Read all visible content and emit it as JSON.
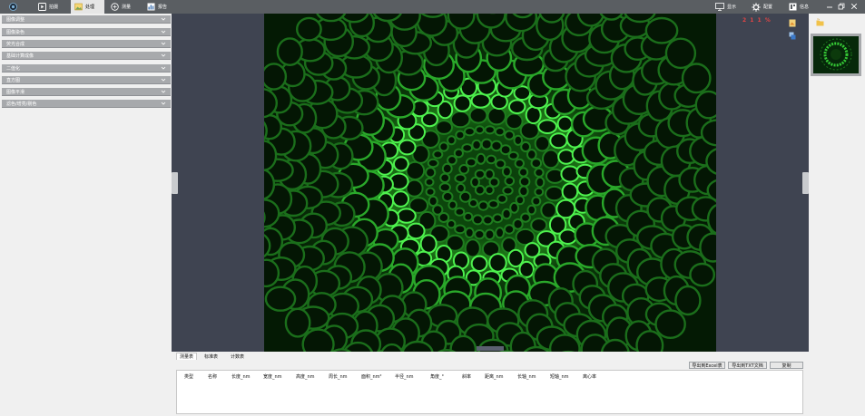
{
  "toolbar": {
    "nav": [
      {
        "label": ""
      },
      {
        "label": "拍摄"
      },
      {
        "label": "处理"
      },
      {
        "label": "测量"
      },
      {
        "label": "报告"
      }
    ],
    "right": [
      {
        "label": "显示"
      },
      {
        "label": "配置"
      },
      {
        "label": "信息"
      }
    ]
  },
  "left_panel": {
    "items": [
      {
        "label": "图像调整"
      },
      {
        "label": "图像染色"
      },
      {
        "label": "荧光合成"
      },
      {
        "label": "基础计算成像"
      },
      {
        "label": "二值化"
      },
      {
        "label": "直方图"
      },
      {
        "label": "图像平滑"
      },
      {
        "label": "滤色/增亮/剔色"
      }
    ]
  },
  "viewer": {
    "stamp": "2 1 1 %"
  },
  "bottom": {
    "tabs": [
      {
        "label": "测量表"
      },
      {
        "label": "标准表"
      },
      {
        "label": "计数表"
      }
    ],
    "buttons": {
      "export_excel": "导出到Excel表",
      "export_txt": "导出到TXT文档",
      "copy": "复制"
    },
    "columns": [
      "类型",
      "名称",
      "长度_nm",
      "宽度_nm",
      "高度_nm",
      "周长_nm",
      "面积_nm²",
      "半径_nm",
      "角度_°",
      "斜率",
      "距离_nm",
      "长轴_nm",
      "短轴_nm",
      "离心率"
    ]
  },
  "colors": {
    "toolbar_bg": "#5a5e62",
    "accordion_bg": "#a7a9ac",
    "viewer_bg": "#3f4451",
    "fluorescence": "#2bd62b",
    "accent": "#e24545"
  },
  "icons": {
    "logo": "logo-icon",
    "capture": "camera-icon",
    "process": "image-icon",
    "measure": "ruler-icon",
    "report": "report-icon",
    "display": "monitor-icon",
    "config": "gear-icon",
    "info": "info-icon"
  }
}
